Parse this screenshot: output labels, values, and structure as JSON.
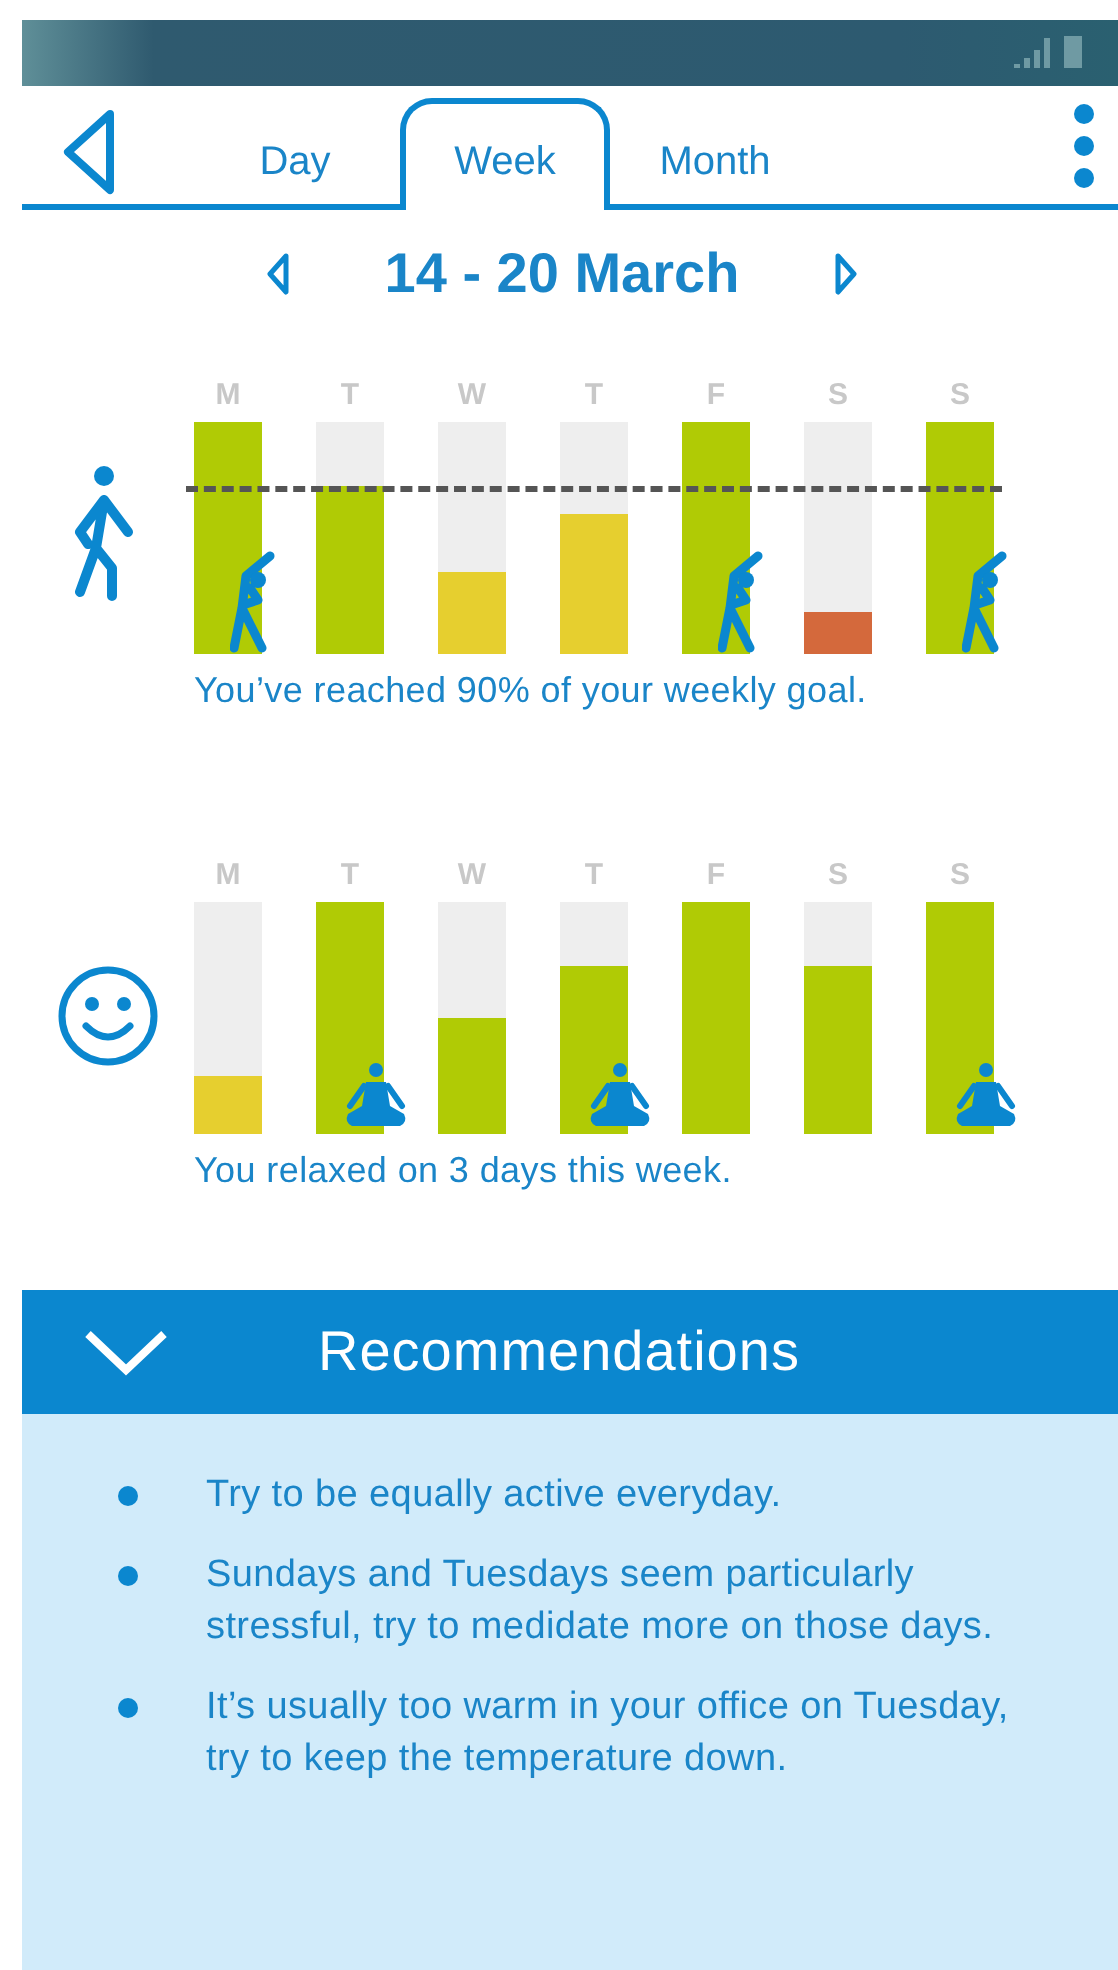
{
  "tabs": [
    {
      "label": "Day",
      "selected": false
    },
    {
      "label": "Week",
      "selected": true
    },
    {
      "label": "Month",
      "selected": false
    }
  ],
  "period": {
    "title": "14 - 20 March"
  },
  "activity": {
    "goal": {
      "level": 0.72
    },
    "summary": "You’ve reached 90% of your weekly goal.",
    "days": [
      {
        "label": "M",
        "level": 1,
        "color": "#b0cb05",
        "exercised": true
      },
      {
        "label": "T",
        "level": 0.72,
        "color": "#b0cb05",
        "exercised": false
      },
      {
        "label": "W",
        "level": 0.35,
        "color": "#e6cf2f",
        "exercised": false
      },
      {
        "label": "T",
        "level": 0.6,
        "color": "#e6cf2f",
        "exercised": false
      },
      {
        "label": "F",
        "level": 1,
        "color": "#b0cb05",
        "exercised": true
      },
      {
        "label": "S",
        "level": 0.18,
        "color": "#d4693c",
        "exercised": false
      },
      {
        "label": "S",
        "level": 1,
        "color": "#b0cb05",
        "exercised": true
      }
    ]
  },
  "relaxation": {
    "summary": "You relaxed on 3 days this week.",
    "days": [
      {
        "label": "M",
        "level": 0.25,
        "color": "#e6cf2f",
        "meditated": false
      },
      {
        "label": "T",
        "level": 1,
        "color": "#b0cb05",
        "meditated": true
      },
      {
        "label": "W",
        "level": 0.5,
        "color": "#b0cb05",
        "meditated": false
      },
      {
        "label": "T",
        "level": 0.72,
        "color": "#b0cb05",
        "meditated": true
      },
      {
        "label": "F",
        "level": 1,
        "color": "#b0cb05",
        "meditated": false
      },
      {
        "label": "S",
        "level": 0.72,
        "color": "#b0cb05",
        "meditated": false
      },
      {
        "label": "S",
        "level": 1,
        "color": "#b0cb05",
        "meditated": true
      }
    ]
  },
  "recommendations": {
    "title": "Recommendations",
    "expanded": true,
    "items": [
      "Try to be equally active everyday.",
      "Sundays and Tuesdays seem particularly stressful, try to medidate more on those days.",
      "It’s usually too warm in your office on Tuesday, try to keep the temperature down."
    ]
  }
}
